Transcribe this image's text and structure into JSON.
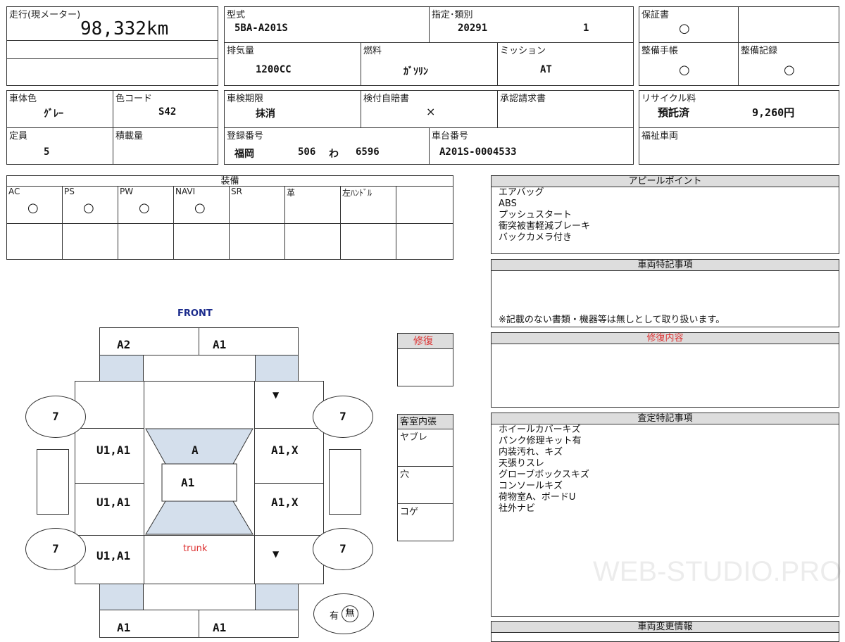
{
  "top": {
    "mileage_label": "走行(現メーター)",
    "mileage_value": "98,332km",
    "model_label": "型式",
    "model_value": "5BA-A201S",
    "designation_label": "指定･類別",
    "designation_value": "20291",
    "class_value": "1",
    "warranty_label": "保証書",
    "warranty_value": "○",
    "displacement_label": "排気量",
    "displacement_value": "1200CC",
    "fuel_label": "燃料",
    "fuel_value": "ｶﾞｿﾘﾝ",
    "mission_label": "ミッション",
    "mission_value": "AT",
    "maint_book_label": "整備手帳",
    "maint_book_value": "○",
    "maint_record_label": "整備記録",
    "maint_record_value": "○",
    "color_label": "車体色",
    "color_value": "ｸﾞﾚｰ",
    "color_code_label": "色コード",
    "color_code_value": "S42",
    "inspection_label": "車検期限",
    "inspection_value": "抹消",
    "insurance_label": "検付自賠書",
    "insurance_value": "×",
    "approval_label": "承認請求書",
    "recycle_label": "リサイクル料",
    "recycle_status": "預託済",
    "recycle_amount": "9,260円",
    "capacity_label": "定員",
    "capacity_value": "5",
    "load_label": "積載量",
    "reg_label": "登録番号",
    "reg_area": "福岡",
    "reg_num": "506",
    "reg_kana": "わ",
    "reg_serial": "6596",
    "chassis_label": "車台番号",
    "chassis_value": "A201S-0004533",
    "welfare_label": "福祉車両"
  },
  "equipment": {
    "title": "装備",
    "items": [
      {
        "label": "AC",
        "value": "○"
      },
      {
        "label": "PS",
        "value": "○"
      },
      {
        "label": "PW",
        "value": "○"
      },
      {
        "label": "NAVI",
        "value": "○"
      },
      {
        "label": "SR",
        "value": ""
      },
      {
        "label": "革",
        "value": ""
      },
      {
        "label": "左ﾊﾝﾄﾞﾙ",
        "value": ""
      }
    ]
  },
  "appeal": {
    "title": "アピールポイント",
    "lines": [
      "エアバッグ",
      "ABS",
      "プッシュスタート",
      "衝突被害軽減ブレーキ",
      "バックカメラ付き"
    ]
  },
  "special_notes": {
    "title": "車両特記事項",
    "note": "※記載のない書類・機器等は無しとして取り扱います。"
  },
  "repair": {
    "box_title": "修復",
    "content_title": "修復内容"
  },
  "interior": {
    "title": "客室内張",
    "rows": [
      "ヤブレ",
      "穴",
      "コゲ"
    ]
  },
  "assessment": {
    "title": "査定特記事項",
    "lines": [
      "ホイールカバーキズ",
      "パンク修理キット有",
      "内装汚れ、キズ",
      "天張りスレ",
      "グローブボックスキズ",
      "コンソールキズ",
      "荷物室A、ボードU",
      "社外ナビ"
    ]
  },
  "change_info": {
    "title": "車両変更情報"
  },
  "diagram": {
    "front": "FRONT",
    "trunk": "trunk",
    "front_left": "A2",
    "front_right": "A1",
    "rear_left": "A1",
    "rear_right": "A1",
    "left_front_door": "U1,A1",
    "left_rear_door": "U1,A1",
    "left_rear": "U1,A1",
    "right_front_door": "A1,X",
    "right_rear_door": "A1,X",
    "windshield": "A",
    "roof": "A1",
    "tire_fl": "7",
    "tire_fr": "7",
    "tire_rl": "7",
    "tire_rr": "7",
    "mirror_mark": "▼",
    "rear_mark": "▼",
    "spare_present": "有",
    "spare_absent": "無"
  },
  "watermark": "WEB-STUDIO.PRO"
}
